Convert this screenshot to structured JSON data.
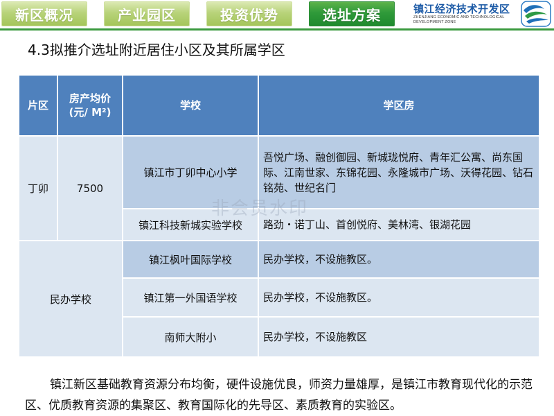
{
  "nav": {
    "tabs": [
      {
        "label": "新区概况",
        "active": false
      },
      {
        "label": "产业园区",
        "active": false
      },
      {
        "label": "投资优势",
        "active": false
      },
      {
        "label": "选址方案",
        "active": true
      }
    ]
  },
  "brand": {
    "title": "镇江经济技术开发区",
    "subtitle": "ZHENJIANG ECONOMIC AND TECHNOLOGICAL DEVELOPMENT ZONE",
    "logo_icon": "wave-logo-icon"
  },
  "heading": "4.3拟推介选址附近居住小区及其所属学区",
  "table": {
    "headers": [
      "片区",
      "房产均价\n(元/ M²)",
      "学校",
      "学区房"
    ],
    "rows": [
      {
        "district": "丁卯",
        "price": "7500",
        "school": "镇江市丁卯中心小学",
        "housing": "吾悦广场、融创御园、新城珑悦府、青年汇公寓、尚东国际、江南世家、东锦花园、永隆城市广场、沃得花园、钻石铭苑、世纪名门"
      },
      {
        "school": "镇江科技新城实验学校",
        "housing": "路劲・诺丁山、首创悦府、美林湾、银湖花园"
      },
      {
        "district": "民办学校",
        "school": "镇江枫叶国际学校",
        "housing": "民办学校，不设施教区。"
      },
      {
        "school": "镇江第一外国语学校",
        "housing": "民办学校，不设施教区。"
      },
      {
        "school": "南师大附小",
        "housing": "民办学校，不设施教区"
      }
    ]
  },
  "watermark": "非会员水印",
  "paragraph": "镇江新区基础教育资源分布均衡，硬件设施优良，师资力量雄厚，是镇江市教育现代化的示范区、优质教育资源的集聚区、教育国际化的先导区、素质教育的实验区。",
  "colors": {
    "header_blue": "#4f81bd",
    "row_blue": "#b8cce4",
    "row_light": "#dce6f1",
    "tab_active": "#2f9a3a",
    "tab_inactive": "#b8d37a"
  }
}
